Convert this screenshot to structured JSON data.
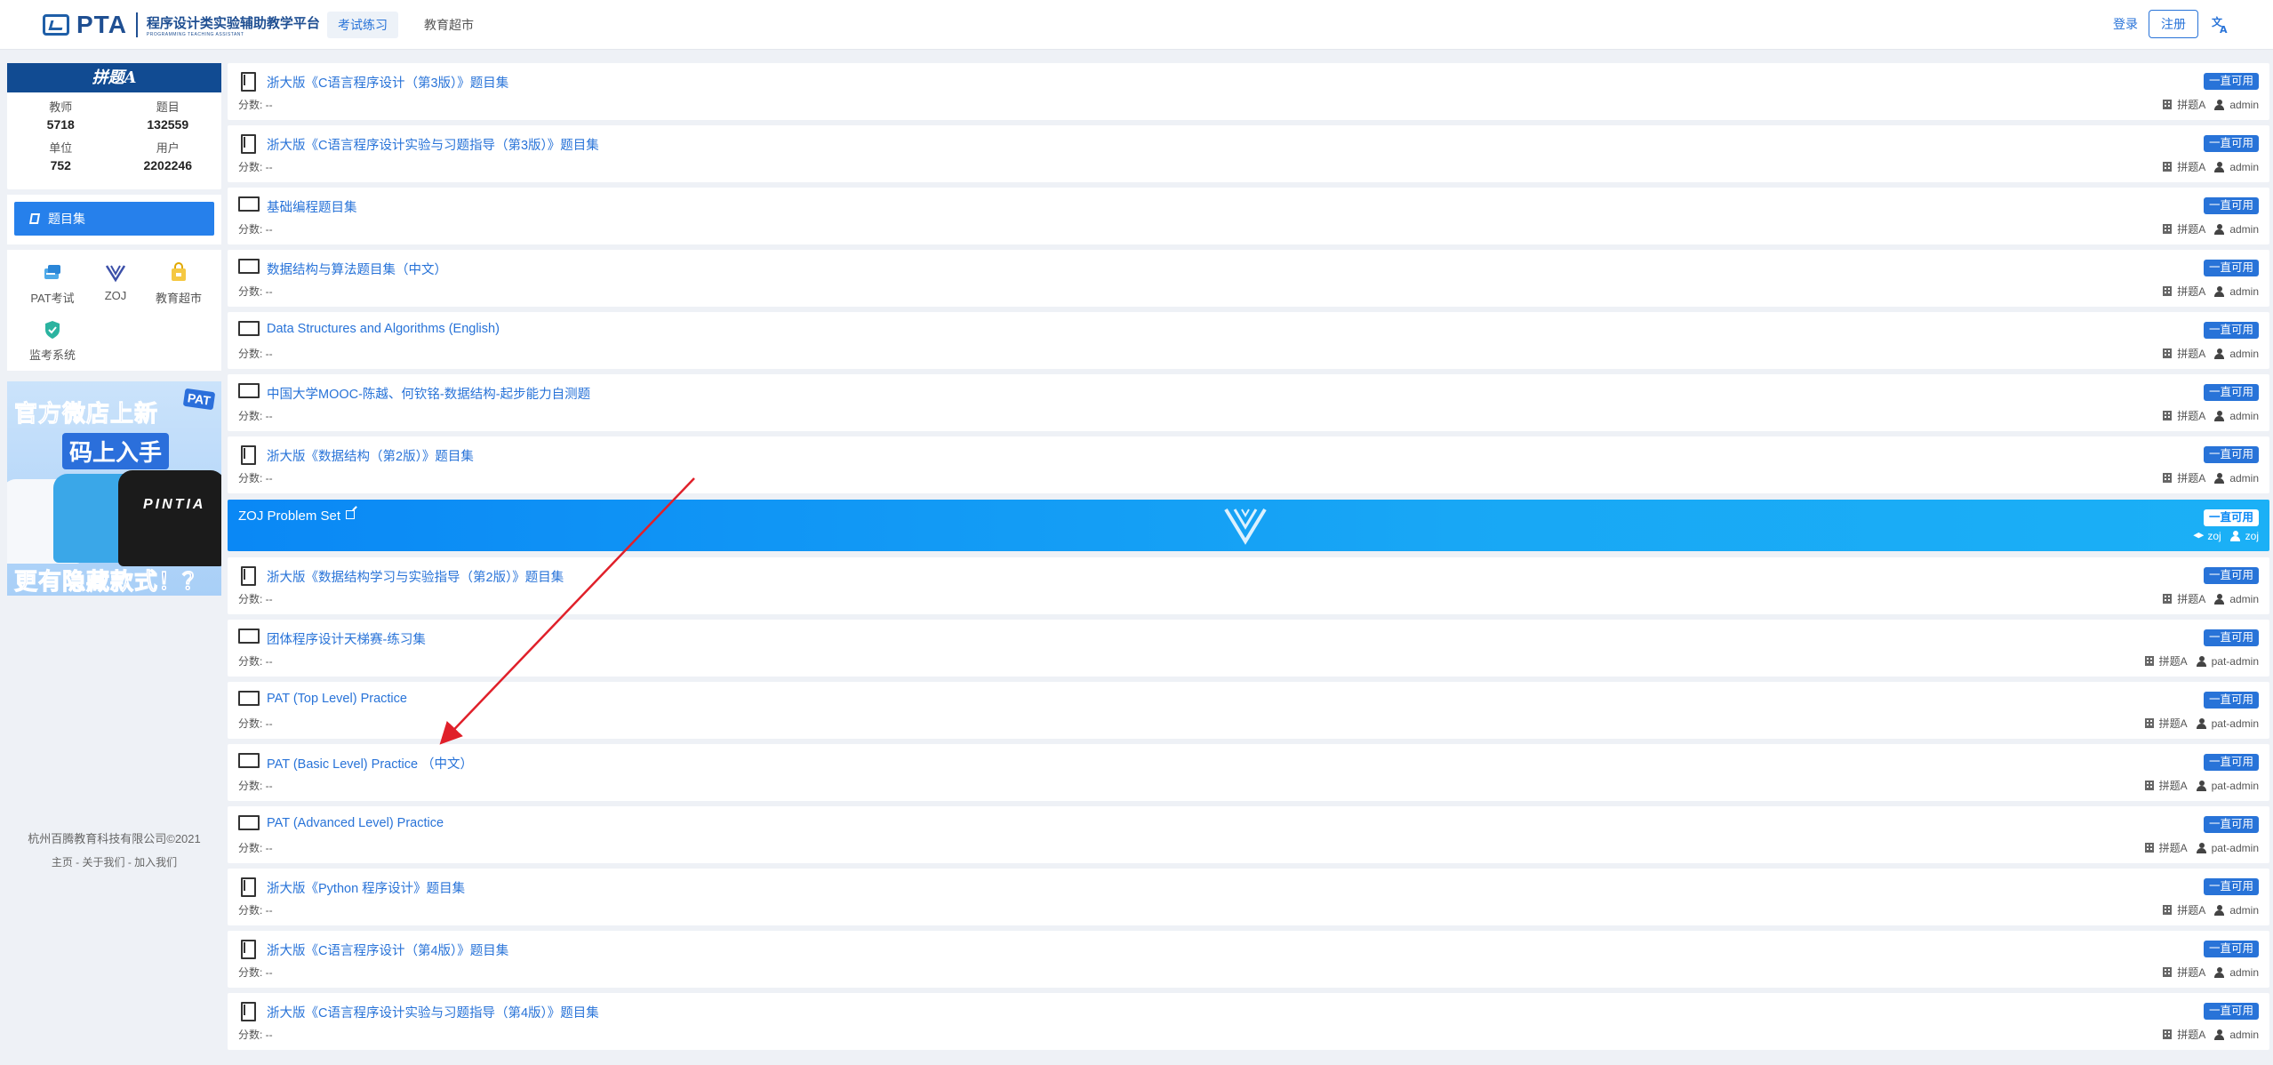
{
  "header": {
    "logo_text": "PTA",
    "logo_subtitle": "程序设计类实验辅助教学平台",
    "logo_subtitle_en": "PROGRAMMING TEACHING ASSISTANT",
    "tabs": [
      {
        "label": "考试练习",
        "active": true
      },
      {
        "label": "教育超市",
        "active": false
      }
    ],
    "login_label": "登录",
    "register_label": "注册",
    "lang_icon": "translate-icon"
  },
  "sidebar": {
    "banner_text": "拼题A",
    "stats": [
      {
        "label": "教师",
        "value": "5718"
      },
      {
        "label": "题目",
        "value": "132559"
      },
      {
        "label": "单位",
        "value": "752"
      },
      {
        "label": "用户",
        "value": "2202246"
      }
    ],
    "menu": [
      {
        "label": "题目集",
        "icon": "book-icon",
        "active": true
      }
    ],
    "apps": [
      {
        "label": "PAT考试",
        "icon": "pat-icon"
      },
      {
        "label": "ZOJ",
        "icon": "zoj-icon"
      },
      {
        "label": "教育超市",
        "icon": "shop-icon"
      },
      {
        "label": "监考系统",
        "icon": "shield-icon"
      }
    ],
    "promo": {
      "line1": "官方微店上新",
      "badge": "PAT",
      "line2": "码上入手",
      "shirt_text": "PINTIA",
      "line3": "更有隐藏款式！？"
    },
    "footer": {
      "copyright": "杭州百腾教育科技有限公司©2021",
      "links": "主页 - 关于我们 - 加入我们"
    }
  },
  "problem_sets": [
    {
      "title": "浙大版《C语言程序设计（第3版）》题目集",
      "icon": "book-icon",
      "score": "分数: --",
      "badge": "一直可用",
      "org": "拼题A",
      "owner": "admin"
    },
    {
      "title": "浙大版《C语言程序设计实验与习题指导（第3版）》题目集",
      "icon": "book-icon",
      "score": "分数: --",
      "badge": "一直可用",
      "org": "拼题A",
      "owner": "admin"
    },
    {
      "title": "基础编程题目集",
      "icon": "monitor-icon",
      "score": "分数: --",
      "badge": "一直可用",
      "org": "拼题A",
      "owner": "admin"
    },
    {
      "title": "数据结构与算法题目集（中文）",
      "icon": "monitor-icon",
      "score": "分数: --",
      "badge": "一直可用",
      "org": "拼题A",
      "owner": "admin"
    },
    {
      "title": "Data Structures and Algorithms (English)",
      "icon": "monitor-icon",
      "score": "分数: --",
      "badge": "一直可用",
      "org": "拼题A",
      "owner": "admin"
    },
    {
      "title": "中国大学MOOC-陈越、何钦铭-数据结构-起步能力自测题",
      "icon": "monitor-icon",
      "score": "分数: --",
      "badge": "一直可用",
      "org": "拼题A",
      "owner": "admin"
    },
    {
      "title": "浙大版《数据结构（第2版）》题目集",
      "icon": "book-icon",
      "score": "分数: --",
      "badge": "一直可用",
      "org": "拼题A",
      "owner": "admin"
    },
    {
      "title": "ZOJ Problem Set",
      "icon": "external-link-icon",
      "score": "",
      "badge": "一直可用",
      "org": "zoj",
      "owner": "zoj",
      "highlight": true
    },
    {
      "title": "浙大版《数据结构学习与实验指导（第2版）》题目集",
      "icon": "book-icon",
      "score": "分数: --",
      "badge": "一直可用",
      "org": "拼题A",
      "owner": "admin"
    },
    {
      "title": "团体程序设计天梯赛-练习集",
      "icon": "monitor-icon",
      "score": "分数: --",
      "badge": "一直可用",
      "org": "拼题A",
      "owner": "pat-admin"
    },
    {
      "title": "PAT (Top Level) Practice",
      "icon": "monitor-icon",
      "score": "分数: --",
      "badge": "一直可用",
      "org": "拼题A",
      "owner": "pat-admin"
    },
    {
      "title": "PAT (Basic Level) Practice （中文）",
      "icon": "monitor-icon",
      "score": "分数: --",
      "badge": "一直可用",
      "org": "拼题A",
      "owner": "pat-admin"
    },
    {
      "title": "PAT (Advanced Level) Practice",
      "icon": "monitor-icon",
      "score": "分数: --",
      "badge": "一直可用",
      "org": "拼题A",
      "owner": "pat-admin"
    },
    {
      "title": "浙大版《Python 程序设计》题目集",
      "icon": "book-icon",
      "score": "分数: --",
      "badge": "一直可用",
      "org": "拼题A",
      "owner": "admin"
    },
    {
      "title": "浙大版《C语言程序设计（第4版）》题目集",
      "icon": "book-icon",
      "score": "分数: --",
      "badge": "一直可用",
      "org": "拼题A",
      "owner": "admin"
    },
    {
      "title": "浙大版《C语言程序设计实验与习题指导（第4版）》题目集",
      "icon": "book-icon",
      "score": "分数: --",
      "badge": "一直可用",
      "org": "拼题A",
      "owner": "admin"
    }
  ],
  "colors": {
    "brand": "#1f4f92",
    "accent": "#2873d8",
    "zoj_highlight": "#0a88f5",
    "annotation_arrow": "#e0202a"
  }
}
